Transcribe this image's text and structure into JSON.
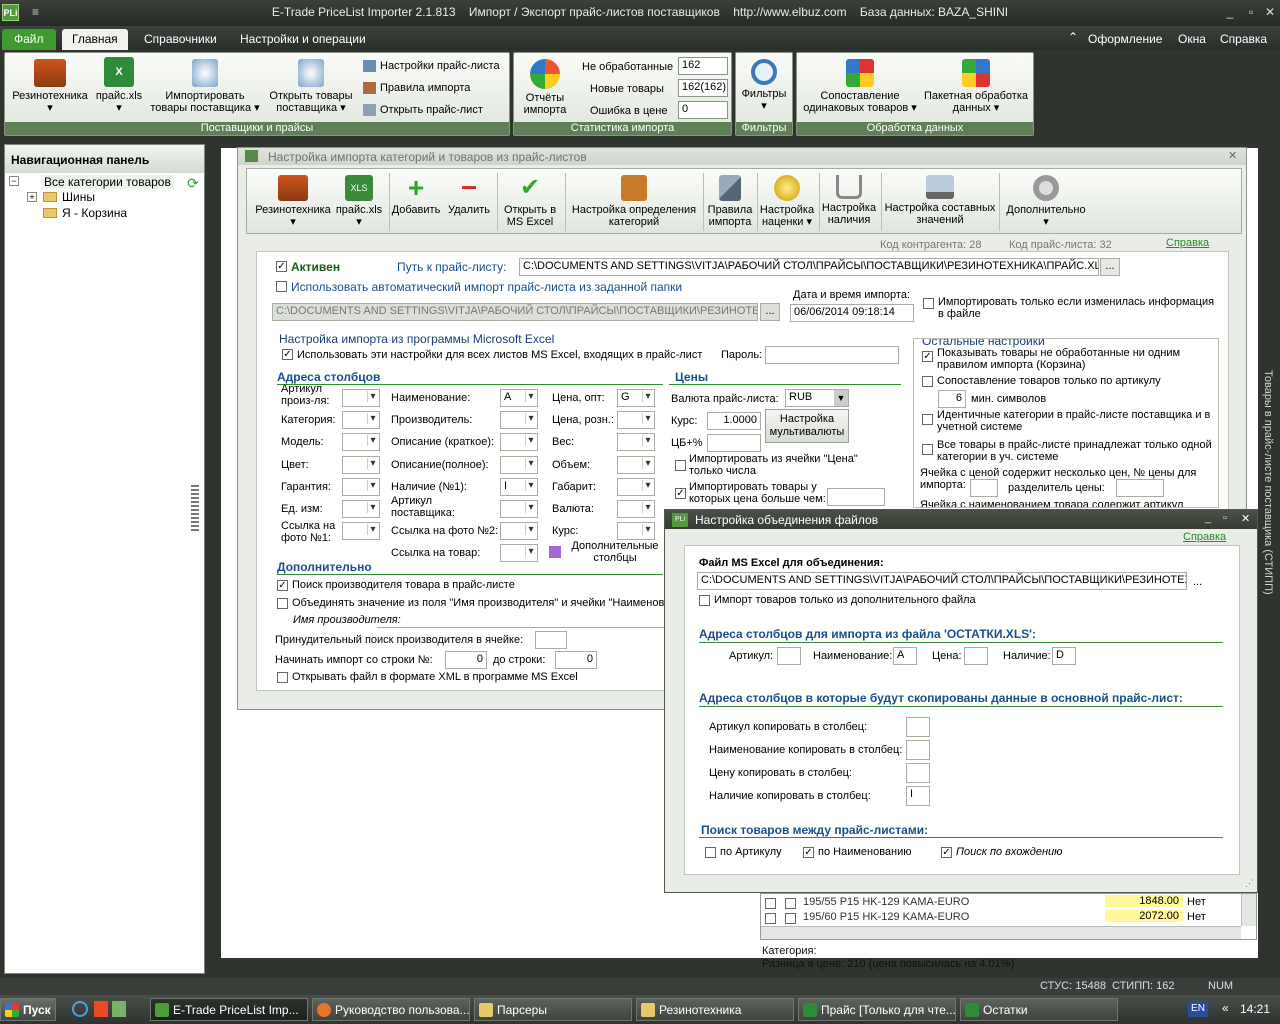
{
  "window": {
    "icon": "PLi",
    "title": "E-Trade PriceList Importer 2.1.813    Импорт / Экспорт прайс-листов поставщиков    http://www.elbuz.com    База данных: BAZA_SHINI"
  },
  "menu": {
    "tabs": [
      "Файл",
      "Главная",
      "Справочники",
      "Настройки и операции"
    ],
    "right": [
      "Оформление",
      "Окна",
      "Справка"
    ]
  },
  "ribbon": {
    "groups": [
      {
        "title": "Поставщики и прайсы",
        "buttons": [
          "Резинотехника",
          "прайс.xls",
          "Импортировать товары поставщика",
          "Открыть товары поставщика"
        ],
        "small": [
          "Настройки прайс-листа",
          "Правила импорта",
          "Открыть прайс-лист"
        ]
      },
      {
        "title": "Статистика импорта",
        "buttons": [
          "Отчёты импорта"
        ],
        "stats": [
          {
            "label": "Не обработанные",
            "value": "162"
          },
          {
            "label": "Новые товары",
            "value": "162(162)"
          },
          {
            "label": "Ошибка в цене",
            "value": "0"
          }
        ]
      },
      {
        "title": "Фильтры",
        "buttons": [
          "Фильтры"
        ]
      },
      {
        "title": "Обработка данных",
        "buttons": [
          "Сопоставление одинаковых товаров",
          "Пакетная обработка данных"
        ]
      }
    ]
  },
  "nav": {
    "title": "Навигационная панель",
    "items": [
      "Все категории товаров",
      "Шины",
      "Я - Корзина"
    ]
  },
  "dialog1": {
    "title": "Настройка импорта категорий и товаров из прайс-листов",
    "toolbar": [
      "Резинотехника",
      "прайс.xls",
      "Добавить",
      "Удалить",
      "Открыть в MS Excel",
      "Настройка определения категорий",
      "Правила импорта",
      "Настройка наценки",
      "Настройка наличия",
      "Настройка составных значений",
      "Дополнительно"
    ],
    "kod_kontragenta": "Код контрагента: 28",
    "kod_prajs": "Код прайс-листа: 32",
    "help": "Справка",
    "active_label": "Активен",
    "path_label": "Путь к прайс-листу:",
    "path_value": "C:\\DOCUMENTS AND SETTINGS\\VITJA\\РАБОЧИЙ СТОЛ\\ПРАЙСЫ\\ПОСТАВЩИКИ\\РЕЗИНОТЕХНИКА\\ПРАЙС.XLS",
    "auto_import": "Использовать автоматический импорт прайс-листа из заданной папки",
    "auto_path": "C:\\DOCUMENTS AND SETTINGS\\VITJA\\РАБОЧИЙ СТОЛ\\ПРАЙСЫ\\ПОСТАВЩИКИ\\РЕЗИНОТЕХНИКА",
    "datetime_label": "Дата и время импорта:",
    "datetime_value": "06/06/2014 09:18:14",
    "import_if_changed": "Импортировать только если изменилась информация в файле",
    "excel_section": "Настройка импорта из программы Microsoft Excel",
    "use_all_sheets": "Использовать эти настройки для всех листов MS Excel, входящих в прайс-лист",
    "password": "Пароль:",
    "columns_title": "Адреса столбцов",
    "col_fields": [
      {
        "label": "Артикул произ-ля:",
        "value": ""
      },
      {
        "label": "Категория:",
        "value": ""
      },
      {
        "label": "Модель:",
        "value": ""
      },
      {
        "label": "Цвет:",
        "value": ""
      },
      {
        "label": "Гарантия:",
        "value": ""
      },
      {
        "label": "Ед. изм:",
        "value": ""
      },
      {
        "label": "Ссылка на фото №1:",
        "value": ""
      },
      {
        "label": "Наименование:",
        "value": "A"
      },
      {
        "label": "Производитель:",
        "value": ""
      },
      {
        "label": "Описание (краткое):",
        "value": ""
      },
      {
        "label": "Описание(полное):",
        "value": ""
      },
      {
        "label": "Наличие (№1):",
        "value": "I"
      },
      {
        "label": "Артикул поставщика:",
        "value": ""
      },
      {
        "label": "Ссылка на фото №2:",
        "value": ""
      },
      {
        "label": "Ссылка на товар:",
        "value": ""
      },
      {
        "label": "Цена, опт:",
        "value": "G"
      },
      {
        "label": "Цена, розн.:",
        "value": ""
      },
      {
        "label": "Вес:",
        "value": ""
      },
      {
        "label": "Объем:",
        "value": ""
      },
      {
        "label": "Габарит:",
        "value": ""
      },
      {
        "label": "Валюта:",
        "value": ""
      },
      {
        "label": "Курс:",
        "value": ""
      }
    ],
    "extra_cols": "Дополнительные столбцы",
    "prices_title": "Цены",
    "currency_label": "Валюта прайс-листа:",
    "currency_value": "RUB",
    "rate_label": "Курс:",
    "rate_value": "1.0000",
    "cb_label": "ЦБ+%",
    "multicurrency": "Настройка мультивалюты",
    "import_price_num": "Импортировать из ячейки \"Цена\" только числа",
    "import_price_gt": "Импортировать товары у которых цена больше чем:",
    "extra_title": "Дополнительно",
    "search_manuf": "Поиск производителя товара в прайс-листе",
    "merge_name": "Объединять значение из поля \"Имя производителя\" и ячейки \"Наименова",
    "manuf_name": "Имя производителя:",
    "force_search": "Принудительный поиск производителя в ячейке:",
    "start_row_label": "Начинать импорт со строки №:",
    "start_row": "0",
    "to_row_label": "до строки:",
    "to_row": "0",
    "open_xml": "Открывать файл в формате XML в программе MS Excel",
    "other_title": "Остальные настройки",
    "other": [
      "Показывать товары не обработанные ни одним правилом импорта (Корзина)",
      "Сопоставление товаров только по артикулу",
      "мин. символов",
      "Идентичные категории в прайс-листе поставщика и в учетной системе",
      "Все товары в прайс-листе принадлежат только одной категории в уч. системе",
      "Ячейка с ценой содержит несколько цен, № цены для импорта:",
      "разделитель цены:",
      "Ячейка с наименованием товара содержит артикул"
    ],
    "min_symbols": "6"
  },
  "dialog2": {
    "title": "Настройка объединения файлов",
    "help": "Справка",
    "file_label": "Файл MS Excel для объединения:",
    "file_value": "C:\\DOCUMENTS AND SETTINGS\\VITJA\\РАБОЧИЙ СТОЛ\\ПРАЙСЫ\\ПОСТАВЩИКИ\\РЕЗИНОТЕХНИКА\\",
    "only_extra": "Импорт товаров только из дополнительного файла",
    "cols_title": "Адреса столбцов для импорта из файла 'ОСТАТКИ.XLS':",
    "art": "Артикул:",
    "art_v": "",
    "name": "Наименование:",
    "name_v": "A",
    "price": "Цена:",
    "price_v": "",
    "avail": "Наличие:",
    "avail_v": "D",
    "copy_title": "Адреса столбцов в которые будут скопированы данные в основной прайс-лист:",
    "copy": [
      {
        "label": "Артикул копировать в столбец:",
        "value": ""
      },
      {
        "label": "Наименование копировать в столбец:",
        "value": ""
      },
      {
        "label": "Цену копировать в столбец:",
        "value": ""
      },
      {
        "label": "Наличие копировать в столбец:",
        "value": "I"
      }
    ],
    "search_title": "Поиск товаров между прайс-листами:",
    "by_art": "по Артикулу",
    "by_name": "по Наименованию",
    "by_entry": "Поиск по вхождению"
  },
  "grid": {
    "rows": [
      {
        "name": "195/55 P15 HK-129 KAMA-EURO",
        "price": "1848.00",
        "avail": "Нет"
      },
      {
        "name": "195/60 P15 HK-129 KAMA-EURO",
        "price": "2072.00",
        "avail": "Нет"
      }
    ],
    "category": "Категория:",
    "diff": "Разница в цене: 210  (цена повысилась на 4.01%)"
  },
  "side_text": "Товары в прайс-листе поставщика (СТИПП)",
  "status": {
    "stus": "СТУС: 15488",
    "stipp": "СТИПП: 162",
    "num": "NUM"
  },
  "taskbar": {
    "start": "Пуск",
    "tasks": [
      "E-Trade PriceList Imp...",
      "Руководство пользова...",
      "Парсеры",
      "Резинотехника",
      "Прайс  [Только для чте...",
      "Остатки"
    ],
    "lang": "EN",
    "time": "14:21"
  }
}
